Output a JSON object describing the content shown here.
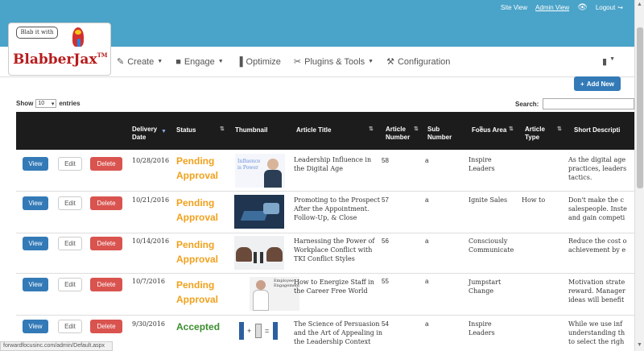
{
  "top": {
    "site_view": "Site View",
    "admin_view": "Admin View",
    "logout": "Logout"
  },
  "logo": {
    "speech": "Blab it with",
    "name": "BlabberJax",
    "tm": "TM"
  },
  "nav": {
    "items": [
      {
        "label": "Create",
        "icon": "pencil-icon",
        "caret": true
      },
      {
        "label": "Engage",
        "icon": "comment-icon",
        "caret": true
      },
      {
        "label": "Optimize",
        "icon": "bar-chart-icon",
        "caret": false
      },
      {
        "label": "Plugins & Tools",
        "icon": "paperclip-icon",
        "caret": true
      },
      {
        "label": "Configuration",
        "icon": "wrench-icon",
        "caret": false
      }
    ]
  },
  "controls": {
    "add_new": "Add New",
    "show": "Show",
    "entries_value": "10",
    "entries": "entries",
    "search": "Search:"
  },
  "columns": {
    "delivery_date": "Delivery Date",
    "status": "Status",
    "thumbnail": "Thumbnail",
    "article_title": "Article Title",
    "article_number": "Article Number",
    "sub_number": "Sub Number",
    "focus_area": "Focus Area",
    "article_type": "Article Type",
    "short_description": "Short Descripti"
  },
  "buttons": {
    "view": "View",
    "edit": "Edit",
    "delete": "Delete"
  },
  "rows": [
    {
      "date": "10/28/2016",
      "status1": "Pending",
      "status2": "Approval",
      "title1": "Leadership Influence in",
      "title2": "the Digital Age",
      "title3": "",
      "number": "58",
      "sub": "a",
      "focus1": "Inspire",
      "focus2": "Leaders",
      "type": "",
      "desc1": "As the digital age",
      "desc2": "practices, leaders",
      "desc3": "tactics.",
      "thumb_text": "Influence is Power"
    },
    {
      "date": "10/21/2016",
      "status1": "Pending",
      "status2": "Approval",
      "title1": "Promoting to the Prospect",
      "title2": "After the Appointment.",
      "title3": "Follow-Up, & Close",
      "number": "57",
      "sub": "a",
      "focus1": "Ignite Sales",
      "focus2": "",
      "type": "How to",
      "desc1": "Don't make the c",
      "desc2": "salespeople. Inste",
      "desc3": "and gain competi",
      "thumb_text": ""
    },
    {
      "date": "10/14/2016",
      "status1": "Pending",
      "status2": "Approval",
      "title1": "Harnessing the Power of",
      "title2": "Workplace Conflict with",
      "title3": "TKI Conflict Styles",
      "number": "56",
      "sub": "a",
      "focus1": "Consciously",
      "focus2": "Communicate",
      "type": "",
      "desc1": "Reduce the cost o",
      "desc2": "achievement by e",
      "desc3": "",
      "thumb_text": ""
    },
    {
      "date": "10/7/2016",
      "status1": "Pending",
      "status2": "Approval",
      "title1": "How to Energize Staff in",
      "title2": "the Career Free World",
      "title3": "",
      "number": "55",
      "sub": "a",
      "focus1": "Jumpstart",
      "focus2": "Change",
      "type": "",
      "desc1": "Motivation strate",
      "desc2": "reward. Manager",
      "desc3": "ideas will benefit",
      "thumb_text": "Employee Engagement"
    },
    {
      "date": "9/30/2016",
      "status1": "Accepted",
      "status2": "",
      "title1": "The Science of Persuasion",
      "title2": "and the Art of Appealing in",
      "title3": "the Leadership Context",
      "number": "54",
      "sub": "a",
      "focus1": "Inspire",
      "focus2": "Leaders",
      "type": "",
      "desc1": "While we use inf",
      "desc2": "understanding th",
      "desc3": "to select the righ",
      "thumb_text": ""
    }
  ],
  "statusbar": "forwardfocusinc.com/admin/Default.aspx",
  "colors": {
    "header_blue": "#4aa3c8",
    "primary": "#337ab7",
    "danger": "#d9534f",
    "pending": "#f0a11c",
    "accepted": "#3c8d2f",
    "table_head": "#1c1c1c"
  }
}
